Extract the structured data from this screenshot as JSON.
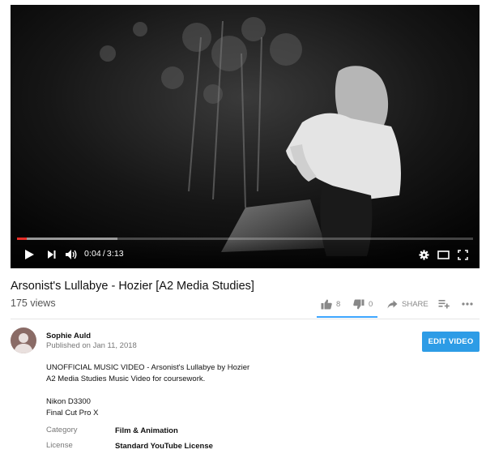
{
  "video": {
    "progress_fraction": 0.021,
    "buffered_fraction": 0.22,
    "current_time": "0:04",
    "separator": "/",
    "duration": "3:13",
    "title": "Arsonist's Lullabye - Hozier [A2 Media Studies]",
    "views": "175 views"
  },
  "actions": {
    "like_count": "8",
    "dislike_count": "0",
    "share_label": "SHARE"
  },
  "channel": {
    "name": "Sophie Auld",
    "published": "Published on Jan 11, 2018",
    "edit_label": "EDIT VIDEO"
  },
  "description": {
    "lines": [
      "UNOFFICIAL MUSIC VIDEO - Arsonist's Lullabye by Hozier",
      "A2 Media Studies Music Video for coursework.",
      "",
      "Nikon D3300",
      "Final Cut Pro X"
    ]
  },
  "details": {
    "category_label": "Category",
    "category_value": "Film & Animation",
    "license_label": "License",
    "license_value": "Standard YouTube License"
  },
  "colors": {
    "progress": "#e52d27",
    "accent_blue": "#2d9ce6"
  }
}
